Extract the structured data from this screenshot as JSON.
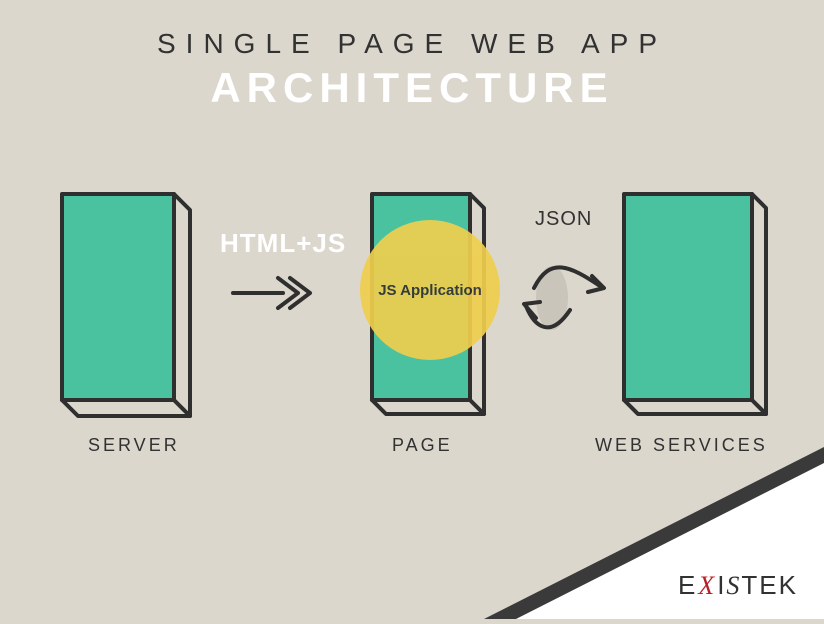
{
  "heading": {
    "top": "SINGLE PAGE WEB APP",
    "bottom": "ARCHITECTURE"
  },
  "nodes": {
    "server": {
      "caption": "SERVER"
    },
    "page": {
      "caption": "PAGE",
      "bubble": "JS Application"
    },
    "web": {
      "caption": "WEB SERVICES"
    }
  },
  "arrows": {
    "server_to_page": {
      "label": "HTML+JS"
    },
    "page_to_web": {
      "label": "JSON"
    }
  },
  "brand": {
    "part1": "E",
    "part2": "X",
    "part3": "I",
    "part4": "S",
    "part5": "TEK"
  },
  "colors": {
    "bg": "#dbd7cd",
    "box_fill": "#4ac2a0",
    "box_stroke": "#2f2f2f",
    "accent": "#efcf4e",
    "white": "#ffffff",
    "dark": "#323232",
    "brand_red": "#b72025"
  }
}
